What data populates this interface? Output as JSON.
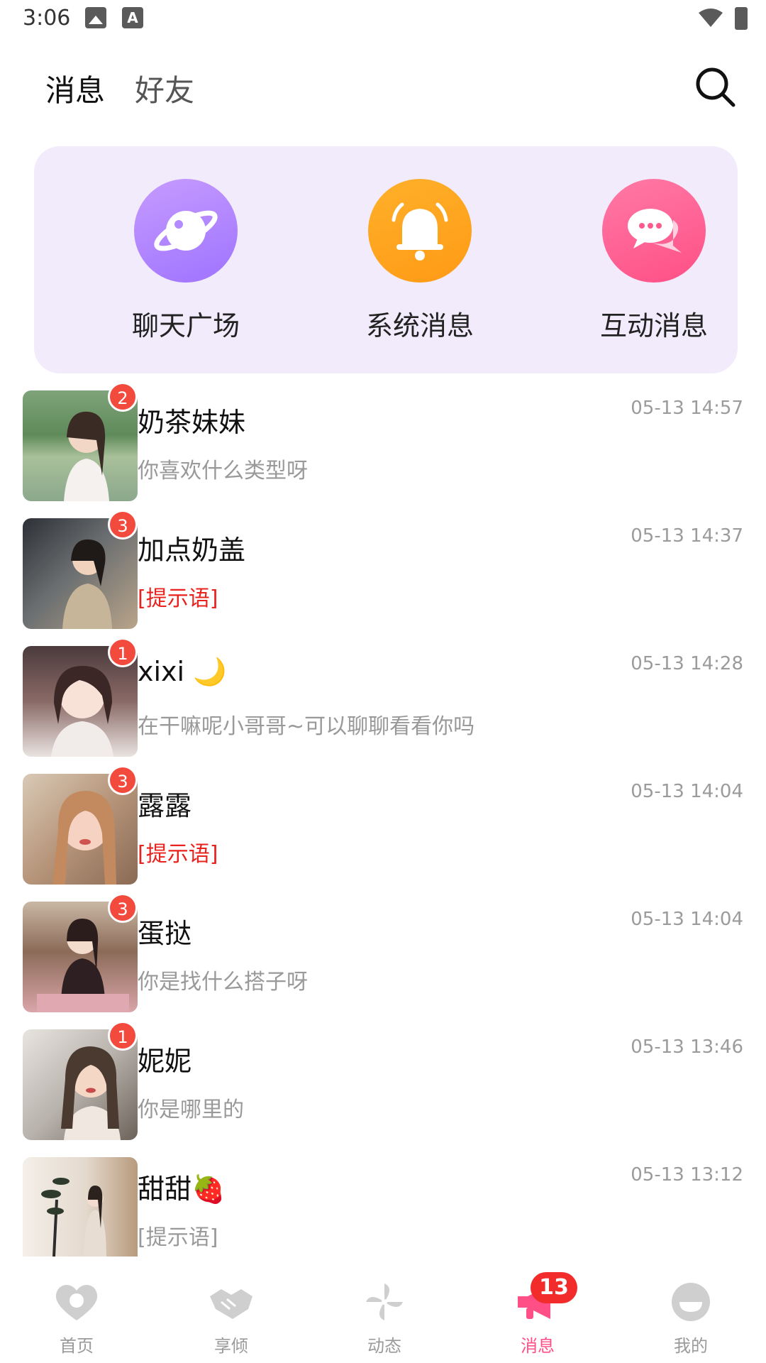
{
  "status_bar": {
    "time": "3:06",
    "icon_a": "A"
  },
  "header": {
    "tabs": [
      {
        "label": "消息"
      },
      {
        "label": "好友"
      }
    ],
    "active_tab": "消息"
  },
  "quick_actions": [
    {
      "label": "聊天广场",
      "icon": "planet-icon",
      "color": "#a77dff"
    },
    {
      "label": "系统消息",
      "icon": "bell-icon",
      "color": "#ffa31f"
    },
    {
      "label": "互动消息",
      "icon": "chat-bubbles-icon",
      "color": "#ff5a8d"
    }
  ],
  "conversations": [
    {
      "name": "奶茶妹妹",
      "preview": "你喜欢什么类型呀",
      "time": "05-13 14:57",
      "badge": "2",
      "preview_style": "normal"
    },
    {
      "name": "加点奶盖",
      "preview": "[提示语]",
      "time": "05-13 14:37",
      "badge": "3",
      "preview_style": "red"
    },
    {
      "name": "xixi 🌙",
      "preview": "在干嘛呢小哥哥~可以聊聊看看你吗",
      "time": "05-13 14:28",
      "badge": "1",
      "preview_style": "normal"
    },
    {
      "name": "露露",
      "preview": "[提示语]",
      "time": "05-13 14:04",
      "badge": "3",
      "preview_style": "red"
    },
    {
      "name": "蛋挞",
      "preview": "你是找什么搭子呀",
      "time": "05-13 14:04",
      "badge": "3",
      "preview_style": "normal"
    },
    {
      "name": "妮妮",
      "preview": "你是哪里的",
      "time": "05-13 13:46",
      "badge": "1",
      "preview_style": "normal"
    },
    {
      "name": "甜甜🍓",
      "preview": "[提示语]",
      "time": "05-13 13:12",
      "badge": "",
      "preview_style": "normal"
    }
  ],
  "bottom_nav": [
    {
      "label": "首页",
      "icon": "home-heart-icon"
    },
    {
      "label": "享倾",
      "icon": "handshake-icon"
    },
    {
      "label": "动态",
      "icon": "pinwheel-icon"
    },
    {
      "label": "消息",
      "icon": "megaphone-icon",
      "badge": "13",
      "active": true
    },
    {
      "label": "我的",
      "icon": "profile-icon"
    }
  ],
  "colors": {
    "accent": "#ff4f86",
    "badge": "#f24a3c",
    "card_bg": "#f1ebfb",
    "warn_text": "#e8231d"
  }
}
